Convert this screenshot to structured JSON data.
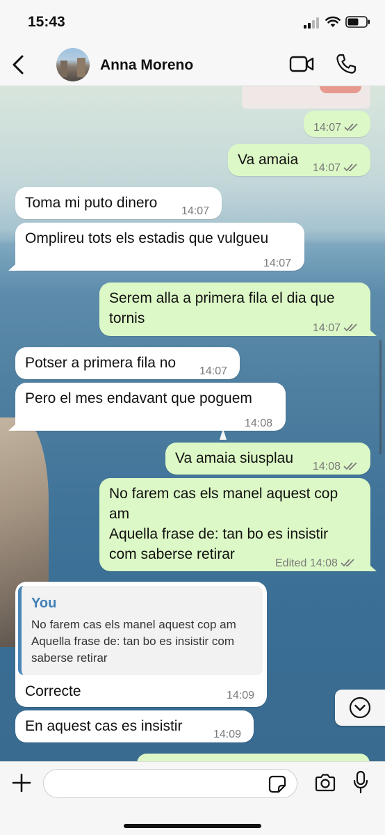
{
  "status_bar": {
    "time": "15:43"
  },
  "header": {
    "contact_name": "Anna Moreno"
  },
  "messages": [
    {
      "dir": "out",
      "text": "",
      "time": "14:07",
      "read": true
    },
    {
      "dir": "out",
      "text": "Va amaia",
      "time": "14:07",
      "read": true
    },
    {
      "dir": "in",
      "text": "Toma mi puto dinero",
      "time": "14:07"
    },
    {
      "dir": "in",
      "text": "Omplireu tots els estadis que vulgueu",
      "time": "14:07"
    },
    {
      "dir": "out",
      "text": "Serem alla a primera fila el dia que\ntornis",
      "time": "14:07",
      "read": true
    },
    {
      "dir": "in",
      "text": "Potser a primera fila no",
      "time": "14:07"
    },
    {
      "dir": "in",
      "text": "Pero el mes endavant que poguem",
      "time": "14:08"
    },
    {
      "dir": "out",
      "text": "Va amaia siusplau",
      "time": "14:08",
      "read": true
    },
    {
      "dir": "out",
      "text": "No farem cas els manel aquest cop\nam\nAquella frase de: tan bo es insistir\ncom saberse retirar",
      "time": "14:08",
      "edited": "Edited",
      "read": true
    },
    {
      "dir": "in",
      "reply": {
        "author": "You",
        "text": "No farem cas els manel aquest cop am\nAquella frase de: tan bo es insistir com\nsaberse retirar"
      },
      "text": "Correcte",
      "time": "14:09"
    },
    {
      "dir": "in",
      "text": "En aquest cas es insistir",
      "time": "14:09"
    }
  ],
  "input": {
    "value": ""
  },
  "icons": {
    "back": "chevron-left-icon",
    "video": "video-camera-icon",
    "call": "phone-icon",
    "scroll": "chevron-down-icon",
    "plus": "plus-icon",
    "sticker": "sticker-icon",
    "camera": "camera-icon",
    "mic": "microphone-icon"
  },
  "colors": {
    "outgoing": "#dcf8c6",
    "incoming": "#ffffff",
    "reply_accent": "#3f7fb6"
  }
}
